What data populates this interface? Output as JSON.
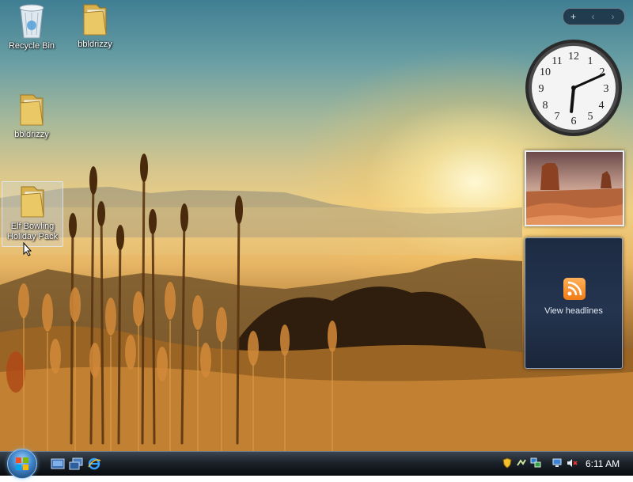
{
  "desktop": {
    "icons": [
      {
        "label": "Recycle Bin",
        "type": "recycle-bin"
      },
      {
        "label": "bbldrizzy",
        "type": "folder"
      },
      {
        "label": "bbldrizzy",
        "type": "folder"
      },
      {
        "label_line1": "Elf Bowling",
        "label_line2": "Holiday Pack",
        "type": "folder",
        "selected": true
      }
    ]
  },
  "sidebar": {
    "controls": {
      "add": "+",
      "prev": "‹",
      "next": "›"
    },
    "clock": {
      "hour": 6,
      "minute": 11
    },
    "feed": {
      "label": "View headlines"
    }
  },
  "taskbar": {
    "quick_launch": [
      "show-desktop-icon",
      "switch-windows-icon",
      "internet-explorer-icon"
    ],
    "tray_icons": [
      "security-shield-icon",
      "windows-defender-icon",
      "network-icon",
      "volume-muted-icon"
    ],
    "time": "6:11 AM"
  },
  "colors": {
    "accent": "#3f83c9",
    "rss": "#f07c14"
  }
}
